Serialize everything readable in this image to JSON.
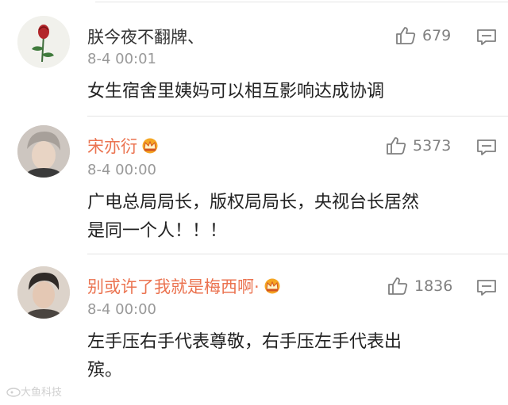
{
  "comments": [
    {
      "username": "朕今夜不翻牌、",
      "vip": false,
      "time": "8-4 00:01",
      "likes": "679",
      "text": "女生宿舍里姨妈可以相互影响达成协调",
      "avatar_icon": "rose-avatar"
    },
    {
      "username": "宋亦衍",
      "vip": true,
      "time": "8-4 00:00",
      "likes": "5373",
      "text": "广电总局局长，版权局局长，央视台长居然\n是同一个人！！！",
      "avatar_icon": "user-photo-avatar"
    },
    {
      "username": "别或许了我就是梅西啊·",
      "vip": true,
      "time": "8-4 00:00",
      "likes": "1836",
      "text": "左手压右手代表尊敬，右手压左手代表出\n殡。",
      "avatar_icon": "user-photo-avatar"
    }
  ],
  "colors": {
    "vip_name": "#eb7350",
    "name": "#333333",
    "meta": "#999999",
    "icon": "#808080"
  },
  "watermark": "大鱼科技"
}
